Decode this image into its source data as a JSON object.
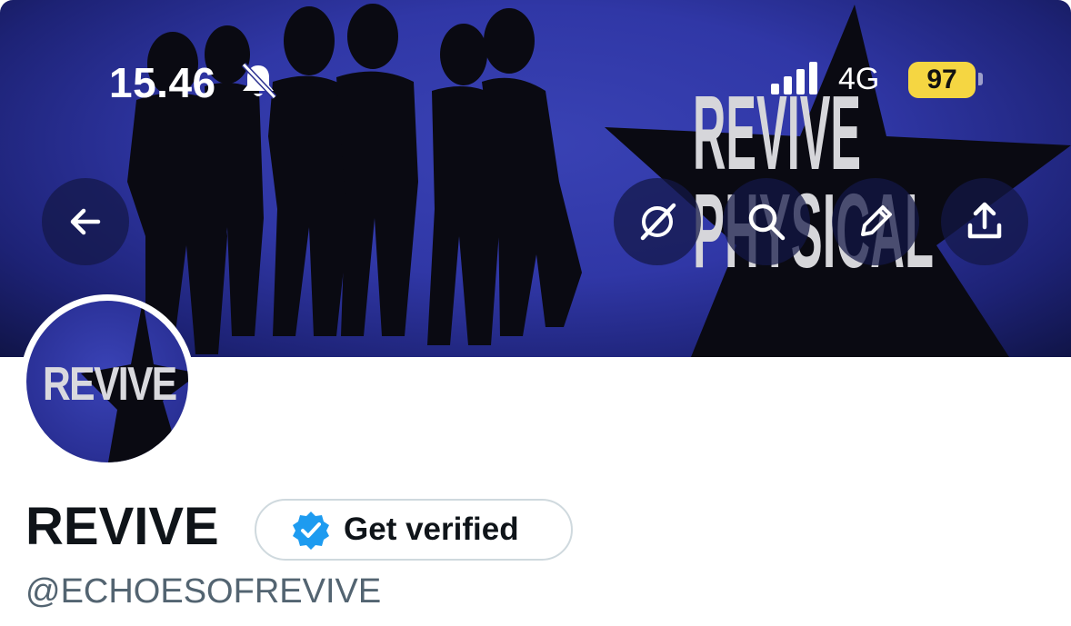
{
  "status_bar": {
    "time": "15.46",
    "network": "4G",
    "battery": "97"
  },
  "banner": {
    "headline_line1": "REVIVE",
    "headline_line2": "PHYSICAL"
  },
  "profile": {
    "avatar_text": "REVIVE",
    "display_name": "REVIVE",
    "verify_label": "Get verified",
    "handle": "@ECHOESOFREVIVE"
  },
  "colors": {
    "banner_blue": "#3037a6",
    "verified_blue": "#1d9bf0",
    "battery_yellow": "#f5d642"
  },
  "icons": [
    "back-arrow-icon",
    "grok-icon",
    "search-icon",
    "edit-pencil-icon",
    "share-icon",
    "bell-muted-icon",
    "verified-badge-icon"
  ]
}
